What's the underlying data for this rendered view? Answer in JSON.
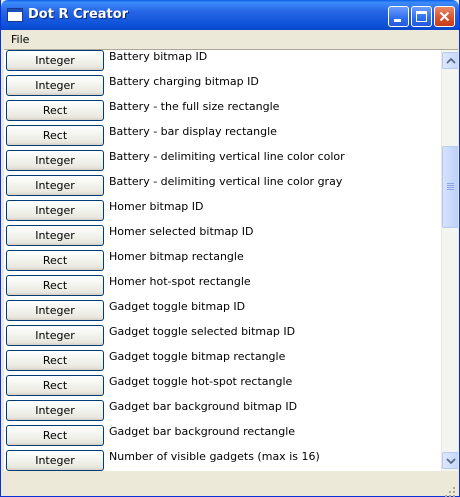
{
  "window": {
    "title": "Dot R Creator"
  },
  "menu": {
    "file": "File"
  },
  "rows": [
    {
      "button": "Integer",
      "label": "Battery bitmap ID"
    },
    {
      "button": "Integer",
      "label": "Battery charging bitmap ID"
    },
    {
      "button": "Rect",
      "label": "Battery - the full size rectangle"
    },
    {
      "button": "Rect",
      "label": "Battery - bar display rectangle"
    },
    {
      "button": "Integer",
      "label": "Battery - delimiting vertical line color color"
    },
    {
      "button": "Integer",
      "label": "Battery - delimiting vertical line color gray"
    },
    {
      "button": "Integer",
      "label": "Homer bitmap ID"
    },
    {
      "button": "Integer",
      "label": "Homer selected bitmap ID"
    },
    {
      "button": "Rect",
      "label": "Homer bitmap rectangle"
    },
    {
      "button": "Rect",
      "label": "Homer hot-spot rectangle"
    },
    {
      "button": "Integer",
      "label": "Gadget toggle bitmap ID"
    },
    {
      "button": "Integer",
      "label": "Gadget toggle selected bitmap ID"
    },
    {
      "button": "Rect",
      "label": "Gadget toggle bitmap rectangle"
    },
    {
      "button": "Rect",
      "label": "Gadget toggle hot-spot rectangle"
    },
    {
      "button": "Integer",
      "label": "Gadget bar background bitmap ID"
    },
    {
      "button": "Rect",
      "label": "Gadget bar background rectangle"
    },
    {
      "button": "Integer",
      "label": "Number of visible gadgets (max is 16)"
    }
  ],
  "icons": {
    "app": "app-window-icon",
    "minimize": "minimize-icon",
    "maximize": "maximize-icon",
    "close": "close-icon",
    "scroll_up": "chevron-up-icon",
    "scroll_down": "chevron-down-icon"
  },
  "colors": {
    "titlebar": "#2664E4",
    "window_face": "#ECE9D8",
    "button_border": "#003C74",
    "close_button": "#D8502C"
  }
}
